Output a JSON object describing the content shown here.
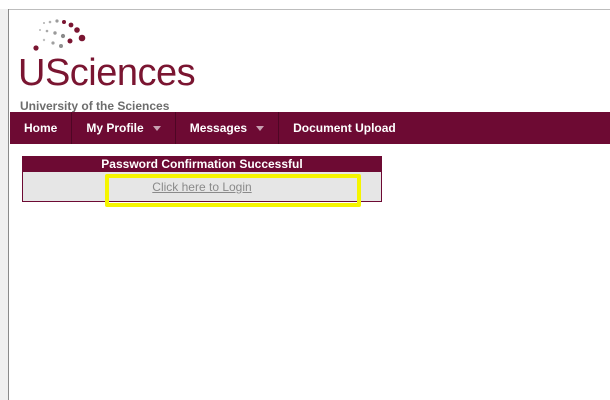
{
  "header": {
    "logo_word": "USciences",
    "logo_subtitle": "University of the Sciences"
  },
  "nav": {
    "home": "Home",
    "my_profile": "My Profile",
    "messages": "Messages",
    "document_upload": "Document Upload"
  },
  "panel": {
    "title": "Password Confirmation Successful",
    "link": "Click here to Login"
  },
  "colors": {
    "brand": "#6d0a33",
    "logo_text": "#7a1531",
    "highlight": "#f5f500"
  }
}
